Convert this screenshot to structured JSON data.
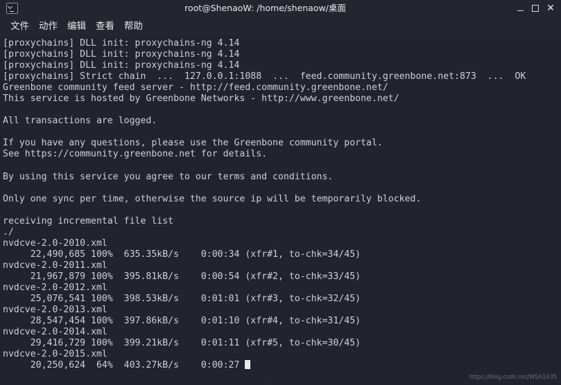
{
  "window": {
    "title": "root@ShenaoW: /home/shenaow/桌面",
    "icon_name": "terminal-icon",
    "controls": {
      "minimize_label": "—",
      "maximize_label": "□",
      "close_label": "✕"
    }
  },
  "menubar": {
    "items": [
      {
        "label": "文件",
        "name": "menu-file"
      },
      {
        "label": "动作",
        "name": "menu-actions"
      },
      {
        "label": "编辑",
        "name": "menu-edit"
      },
      {
        "label": "查看",
        "name": "menu-view"
      },
      {
        "label": "帮助",
        "name": "menu-help"
      }
    ]
  },
  "terminal": {
    "background_color": "#21242e",
    "text_color": "#cdd1d8",
    "cursor": "block",
    "output": "[proxychains] DLL init: proxychains-ng 4.14\n[proxychains] DLL init: proxychains-ng 4.14\n[proxychains] DLL init: proxychains-ng 4.14\n[proxychains] Strict chain  ...  127.0.0.1:1088  ...  feed.community.greenbone.net:873  ...  OK\nGreenbone community feed server - http://feed.community.greenbone.net/\nThis service is hosted by Greenbone Networks - http://www.greenbone.net/\n\nAll transactions are logged.\n\nIf you have any questions, please use the Greenbone community portal.\nSee https://community.greenbone.net for details.\n\nBy using this service you agree to our terms and conditions.\n\nOnly one sync per time, otherwise the source ip will be temporarily blocked.\n\nreceiving incremental file list\n./\nnvdcve-2.0-2010.xml\n     22,490,685 100%  635.35kB/s    0:00:34 (xfr#1, to-chk=34/45)\nnvdcve-2.0-2011.xml\n     21,967,879 100%  395.81kB/s    0:00:54 (xfr#2, to-chk=33/45)\nnvdcve-2.0-2012.xml\n     25,076,541 100%  398.53kB/s    0:01:01 (xfr#3, to-chk=32/45)\nnvdcve-2.0-2013.xml\n     28,547,454 100%  397.86kB/s    0:01:10 (xfr#4, to-chk=31/45)\nnvdcve-2.0-2014.xml\n     29,416,729 100%  399.21kB/s    0:01:11 (xfr#5, to-chk=30/45)\nnvdcve-2.0-2015.xml\n     20,250,624  64%  403.27kB/s    0:00:27 ",
    "transfers": [
      {
        "file": "nvdcve-2.0-2010.xml",
        "bytes": "22,490,685",
        "percent": "100%",
        "rate": "635.35kB/s",
        "elapsed": "0:00:34",
        "xfr": "xfr#1",
        "to_chk": "to-chk=34/45"
      },
      {
        "file": "nvdcve-2.0-2011.xml",
        "bytes": "21,967,879",
        "percent": "100%",
        "rate": "395.81kB/s",
        "elapsed": "0:00:54",
        "xfr": "xfr#2",
        "to_chk": "to-chk=33/45"
      },
      {
        "file": "nvdcve-2.0-2012.xml",
        "bytes": "25,076,541",
        "percent": "100%",
        "rate": "398.53kB/s",
        "elapsed": "0:01:01",
        "xfr": "xfr#3",
        "to_chk": "to-chk=32/45"
      },
      {
        "file": "nvdcve-2.0-2013.xml",
        "bytes": "28,547,454",
        "percent": "100%",
        "rate": "397.86kB/s",
        "elapsed": "0:01:10",
        "xfr": "xfr#4",
        "to_chk": "to-chk=31/45"
      },
      {
        "file": "nvdcve-2.0-2014.xml",
        "bytes": "29,416,729",
        "percent": "100%",
        "rate": "399.21kB/s",
        "elapsed": "0:01:11",
        "xfr": "xfr#5",
        "to_chk": "to-chk=30/45"
      },
      {
        "file": "nvdcve-2.0-2015.xml",
        "bytes": "20,250,624",
        "percent": "64%",
        "rate": "403.27kB/s",
        "elapsed": "0:00:27",
        "xfr": "",
        "to_chk": ""
      }
    ]
  },
  "watermark": {
    "text": "https://blog.csdn.net/WSA1635"
  }
}
